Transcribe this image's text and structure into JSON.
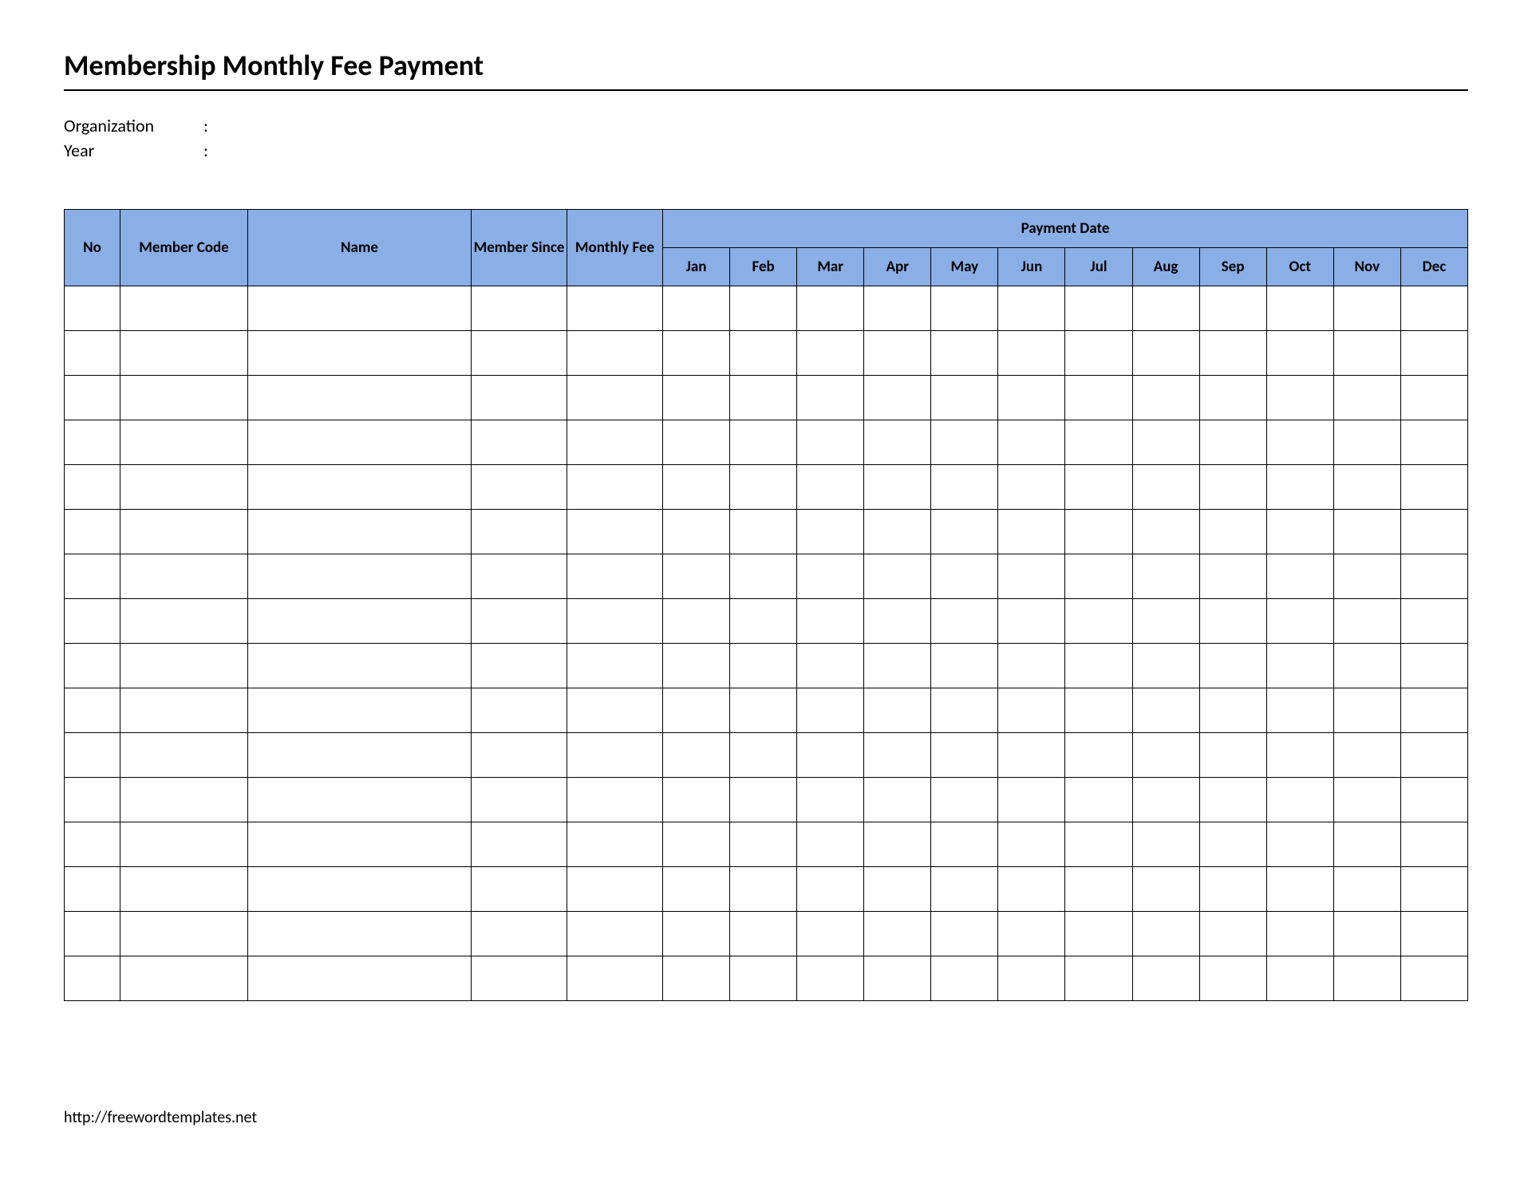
{
  "title": "Membership Monthly Fee Payment",
  "meta": {
    "organization_label": "Organization",
    "organization_value": "",
    "year_label": "Year",
    "year_value": "",
    "colon": ":"
  },
  "table": {
    "headers": {
      "no": "No",
      "member_code": "Member Code",
      "name": "Name",
      "member_since": "Member Since",
      "monthly_fee": "Monthly Fee",
      "payment_date": "Payment Date"
    },
    "months": [
      "Jan",
      "Feb",
      "Mar",
      "Apr",
      "May",
      "Jun",
      "Jul",
      "Aug",
      "Sep",
      "Oct",
      "Nov",
      "Dec"
    ],
    "row_count": 16
  },
  "footer": {
    "url": "http://freewordtemplates.net"
  }
}
